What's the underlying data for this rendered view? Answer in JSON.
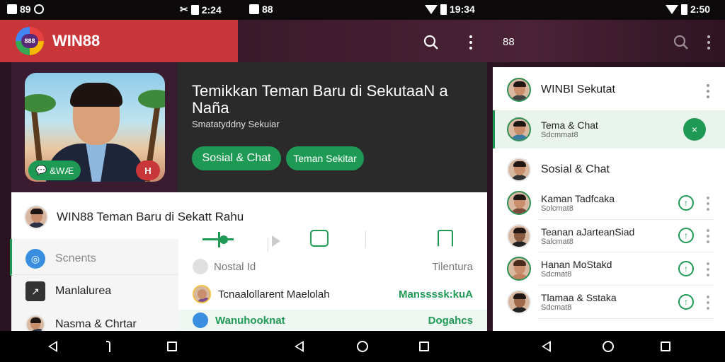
{
  "status_bar": {
    "left_time": "89",
    "mid_time": "2:24",
    "mid2_icon_label": "88",
    "right_mid_time": "19:34",
    "right_time": "2:50"
  },
  "app_bar": {
    "title": "WIN88",
    "logo_text": "888",
    "second_label": "88"
  },
  "hero": {
    "title": "Temikkan Teman Baru di SekutaaN a Naña",
    "subtitle": "Smatatyddny Sekuiar",
    "chip_green": "&WÆ",
    "chip_red": "H",
    "btn_primary": "Sosial & Chat",
    "btn_secondary": "Teman Sekitar"
  },
  "main_list": {
    "top_row": "WIN88 Teman Baru di Sekatt Rahu",
    "sub_items": [
      {
        "label": "Scnents",
        "icon": "target-icon"
      },
      {
        "label": "Manlalurea",
        "icon": "up-arrow-icon"
      },
      {
        "label": "Nasma & Chrtar",
        "icon": "avatar"
      }
    ],
    "mid_header_left": "Nostal Id",
    "mid_header_right": "Tilentura",
    "mid_rows": [
      {
        "label": "Tcnaalollarent Maelolah",
        "value": "Manssssk:kuA"
      },
      {
        "label": "Wanuhooknat",
        "value": "Dogahcs"
      }
    ]
  },
  "right_panel": {
    "header": "WINBI Sekutat",
    "items": [
      {
        "name": "Tema & Chat",
        "sub": "Sdcmmat8",
        "highlight": true,
        "action": "×"
      },
      {
        "name": "Sosial & Chat",
        "sub": "",
        "highlight": false,
        "action": ""
      },
      {
        "name": "Kaman Tadfcaka",
        "sub": "Solcmat8",
        "highlight": false,
        "action": "↑"
      },
      {
        "name": "Teanan aJarteanSiad",
        "sub": "Salcmat8",
        "highlight": false,
        "action": "↑"
      },
      {
        "name": "Hanan MoStakd",
        "sub": "Sdcmat8",
        "highlight": false,
        "action": "↑"
      },
      {
        "name": "Tlamaa & Sstaka",
        "sub": "Sdcmat8",
        "highlight": false,
        "action": "↑"
      }
    ]
  },
  "colors": {
    "green": "#1f9a55",
    "red": "#c8363a",
    "dark": "#2a2a2a"
  }
}
